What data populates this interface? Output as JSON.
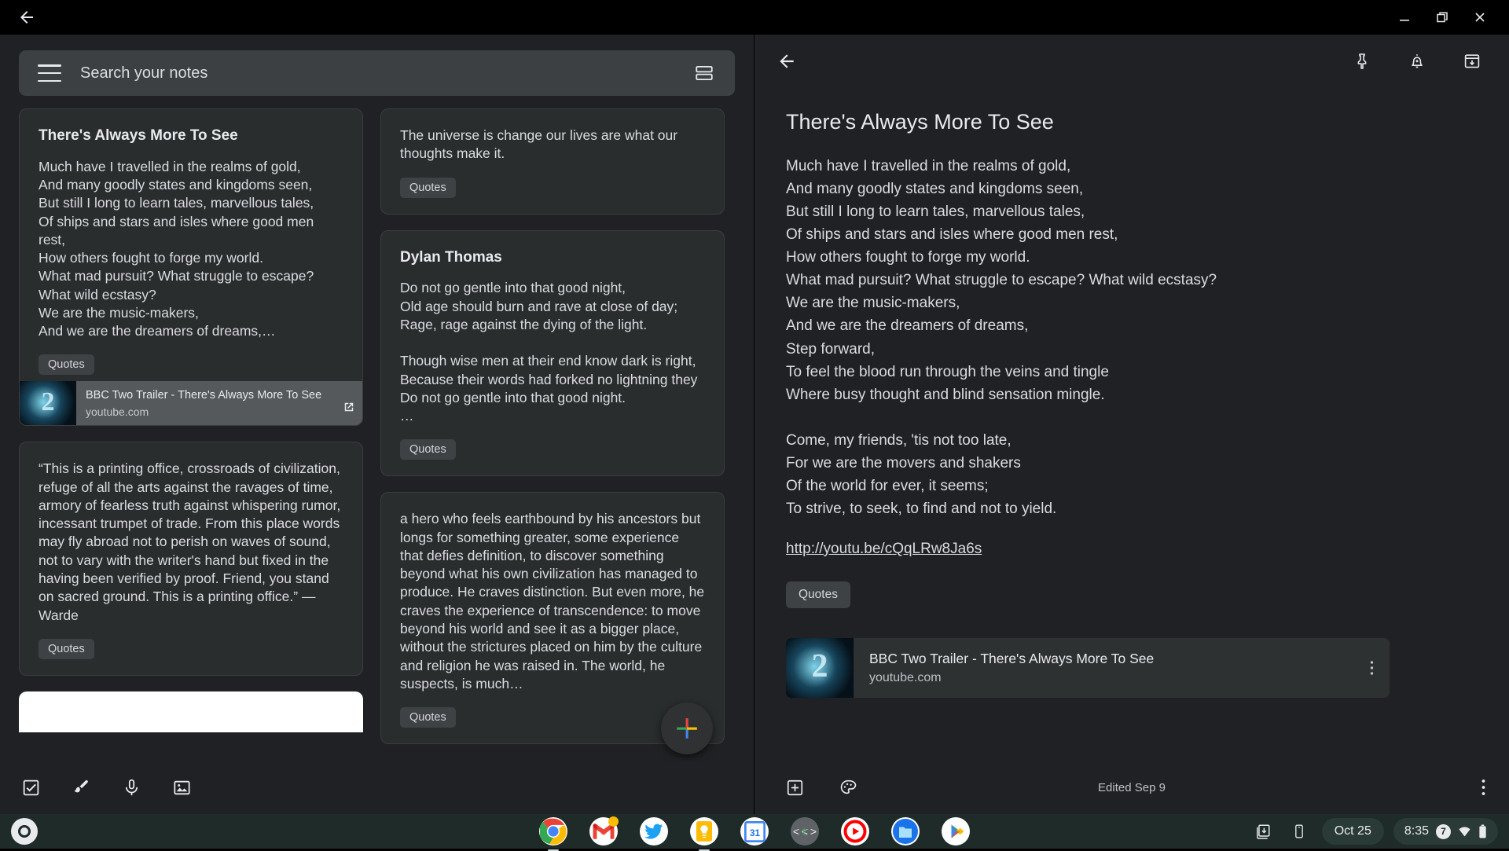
{
  "window": {
    "back_icon": "arrow-left-icon",
    "minimize_icon": "minimize-icon",
    "maximize_icon": "restore-icon",
    "close_icon": "close-icon"
  },
  "search": {
    "placeholder": "Search your notes",
    "menu_icon": "hamburger-menu-icon",
    "view_toggle_icon": "list-view-icon"
  },
  "notes": {
    "column_1": [
      {
        "id": "note-theres-always-more-to-see",
        "title": "There's Always More To See",
        "body": "Much have I travelled in the realms of gold,\nAnd many goodly states and kingdoms seen,\nBut still I long to learn tales, marvellous tales,\nOf ships and stars and isles where good men rest,\nHow others fought to forge my world.\nWhat mad pursuit? What struggle to escape?\nWhat wild ecstasy?\nWe are the music-makers,\nAnd we are the dreamers of dreams,…",
        "label": "Quotes",
        "link": {
          "title": "BBC Two Trailer - There's Always More To See",
          "host": "youtube.com",
          "open_icon": "open-external-icon",
          "thumb_icon": "youtube-thumbnail"
        }
      },
      {
        "id": "note-printing-office",
        "title": "",
        "body": "“This is a printing office, crossroads of civilization, refuge of all the arts against the ravages of time, armory of fearless truth against whispering rumor, incessant trumpet of trade. From this place words may fly abroad not to perish on waves of sound, not to vary with the writer's hand but fixed in the having been verified by proof. Friend, you stand on sacred ground. This is a printing office.” — Warde",
        "label": "Quotes"
      }
    ],
    "column_2": [
      {
        "id": "note-universe-is-change",
        "title": "",
        "body": "The universe is change our lives are what our thoughts make it.",
        "label": "Quotes"
      },
      {
        "id": "note-dylan-thomas",
        "title": "Dylan Thomas",
        "body": "Do not go gentle into that good night,\nOld age should burn and rave at close of day;\nRage, rage against the dying of the light.\n\nThough wise men at their end know dark is right,\nBecause their words had forked no lightning they\nDo not go gentle into that good night.\n…",
        "label": "Quotes"
      },
      {
        "id": "note-hero-earthbound",
        "title": "",
        "body": "a hero who feels earthbound by his ancestors but longs for something greater, some experience that defies definition, to discover something beyond what his own civilization has managed to produce. He craves distinction. But even more, he craves the experience of transcendence: to move beyond his world and see it as a bigger place, without the strictures placed on him by the culture and religion he was raised in. The world, he suspects, is much…",
        "label": "Quotes"
      }
    ],
    "fab_label": "Create new note",
    "fab_icon": "plus-icon"
  },
  "left_toolbar": {
    "items": [
      {
        "icon": "checkbox-list-icon",
        "label": "New list"
      },
      {
        "icon": "brush-icon",
        "label": "New drawing note"
      },
      {
        "icon": "microphone-icon",
        "label": "New recording"
      },
      {
        "icon": "image-icon",
        "label": "New note with image"
      }
    ]
  },
  "detail": {
    "back_icon": "arrow-left-icon",
    "header_actions": [
      {
        "icon": "pin-icon",
        "label": "Pin note"
      },
      {
        "icon": "bell-plus-icon",
        "label": "Remind me"
      },
      {
        "icon": "archive-icon",
        "label": "Archive"
      }
    ],
    "title": "There's Always More To See",
    "body": "Much have I travelled in the realms of gold,\nAnd many goodly states and kingdoms seen,\nBut still I long to learn tales, marvellous tales,\nOf ships and stars and isles where good men rest,\nHow others fought to forge my world.\nWhat mad pursuit? What struggle to escape? What wild ecstasy?\nWe are the music-makers,\nAnd we are the dreamers of dreams,\nStep forward,\nTo feel the blood run through the veins and tingle\nWhere busy thought and blind sensation mingle.\n\nCome, my friends, 'tis not too late,\nFor we are the movers and shakers\nOf the world for ever, it seems;\nTo strive, to seek, to find and not to yield.",
    "url": "http://youtu.be/cQqLRw8Ja6s",
    "label": "Quotes",
    "link_card": {
      "title": "BBC Two Trailer - There's Always More To See",
      "host": "youtube.com",
      "more_icon": "more-vertical-icon",
      "thumb_icon": "youtube-thumbnail"
    },
    "footer": {
      "add_icon": "add-box-icon",
      "palette_icon": "color-palette-icon",
      "edited": "Edited Sep 9",
      "more_icon": "more-vertical-icon"
    }
  },
  "shelf": {
    "launcher_icon": "launcher-icon",
    "apps": [
      {
        "name": "chrome-icon",
        "label": "Chrome",
        "running": true
      },
      {
        "name": "gmail-icon",
        "label": "Gmail",
        "running": false
      },
      {
        "name": "twitter-icon",
        "label": "Twitter",
        "running": false
      },
      {
        "name": "keep-icon",
        "label": "Keep",
        "running": true
      },
      {
        "name": "calendar-icon",
        "label": "Calendar",
        "day": "31",
        "running": false
      },
      {
        "name": "tangent-icon",
        "label": "<t>",
        "running": false
      },
      {
        "name": "youtube-music-icon",
        "label": "YouTube Music",
        "running": false
      },
      {
        "name": "files-icon",
        "label": "Files",
        "running": false
      },
      {
        "name": "play-store-icon",
        "label": "Play Store",
        "running": false
      }
    ],
    "tray": {
      "screen_capture_icon": "screen-capture-icon",
      "phone_hub_icon": "phone-hub-icon",
      "date": "Oct 25",
      "time": "8:35",
      "notification_count": "7",
      "network_icon": "wifi-icon",
      "battery_icon": "battery-icon"
    }
  },
  "colors": {
    "app_background": "#202124",
    "card_background": "#2a2d2e",
    "search_background": "#3c4043",
    "chip_background": "#3f4244",
    "text_primary": "#e8eaed",
    "text_secondary": "#dadce0",
    "shelf_background": "#1e2b28"
  }
}
